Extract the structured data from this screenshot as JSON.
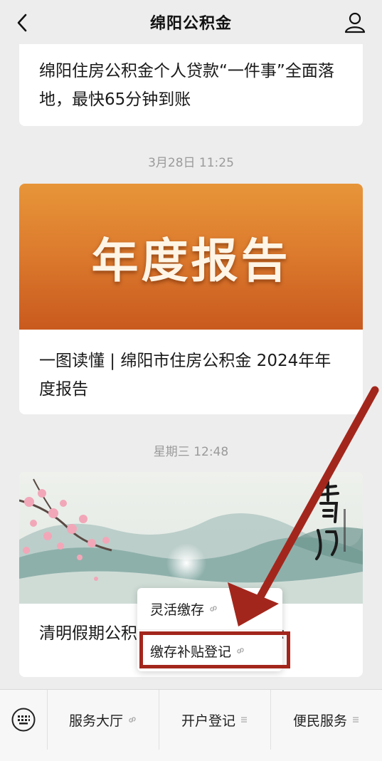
{
  "header": {
    "title": "绵阳公积金"
  },
  "messages": [
    {
      "text": "绵阳住房公积金个人贷款“一件事”全面落地，最快65分钟到账"
    },
    {
      "timestamp": "3月28日 11:25",
      "banner_text": "年度报告",
      "text": "一图读懂 | 绵阳市住房公积金 2024年年度报告"
    },
    {
      "timestamp": "星期三 12:48",
      "text": "清明假期公积金业务办理温馨提示"
    }
  ],
  "popup_menu": {
    "items": [
      {
        "label": "灵活缴存",
        "icon": "link-icon"
      },
      {
        "label": "缴存补贴登记",
        "icon": "link-icon"
      }
    ]
  },
  "bottom_menu": {
    "items": [
      {
        "label": "服务大厅",
        "icon": "link-icon"
      },
      {
        "label": "开户登记",
        "icon": "menu-lines-icon"
      },
      {
        "label": "便民服务",
        "icon": "menu-lines-icon"
      }
    ]
  },
  "colors": {
    "annotation": "#a3261c",
    "background": "#ededed"
  }
}
